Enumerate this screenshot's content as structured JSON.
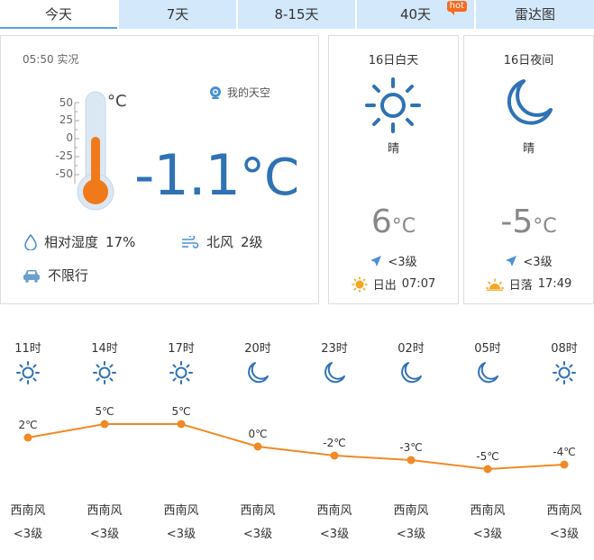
{
  "tabs": [
    {
      "label": "今天",
      "active": true
    },
    {
      "label": "7天"
    },
    {
      "label": "8-15天"
    },
    {
      "label": "40天",
      "badge": "hot"
    },
    {
      "label": "雷达图"
    }
  ],
  "current": {
    "observed": "05:50 实况",
    "my_sky": "我的天空",
    "thermo_unit": "°C",
    "thermo_ticks": [
      "50",
      "25",
      "0",
      "-25",
      "-50"
    ],
    "temperature": "-1.1",
    "temp_unit": "°C",
    "humidity_label": "相对湿度",
    "humidity_value": "17%",
    "wind_dir": "北风",
    "wind_level": "2级",
    "traffic": "不限行"
  },
  "day": {
    "title": "16日白天",
    "condition": "晴",
    "temp": "6",
    "unit": "°C",
    "wind": "<3级",
    "sun_label": "日出",
    "sun_time": "07:07"
  },
  "night": {
    "title": "16日夜间",
    "condition": "晴",
    "temp": "-5",
    "unit": "°C",
    "wind": "<3级",
    "sun_label": "日落",
    "sun_time": "17:49"
  },
  "colors": {
    "accent": "#2f72b5",
    "line": "#f08a24",
    "tab_bg": "#d3e8fb"
  },
  "chart_data": {
    "type": "line",
    "categories": [
      "11时",
      "14时",
      "17时",
      "20时",
      "23时",
      "02时",
      "05时",
      "08时"
    ],
    "icons": [
      "sun-icon",
      "sun-icon",
      "sun-icon",
      "moon-icon",
      "moon-icon",
      "moon-icon",
      "moon-icon",
      "sun-icon"
    ],
    "values": [
      2,
      5,
      5,
      0,
      -2,
      -3,
      -5,
      -4
    ],
    "labels": [
      "2℃",
      "5℃",
      "5℃",
      "0℃",
      "-2℃",
      "-3℃",
      "-5℃",
      "-4℃"
    ],
    "wind_dir": [
      "西南风",
      "西南风",
      "西南风",
      "西南风",
      "西南风",
      "西南风",
      "西南风",
      "西南风"
    ],
    "wind_level": [
      "<3级",
      "<3级",
      "<3级",
      "<3级",
      "<3级",
      "<3级",
      "<3级",
      "<3级"
    ],
    "ylim": [
      -5,
      5
    ]
  }
}
